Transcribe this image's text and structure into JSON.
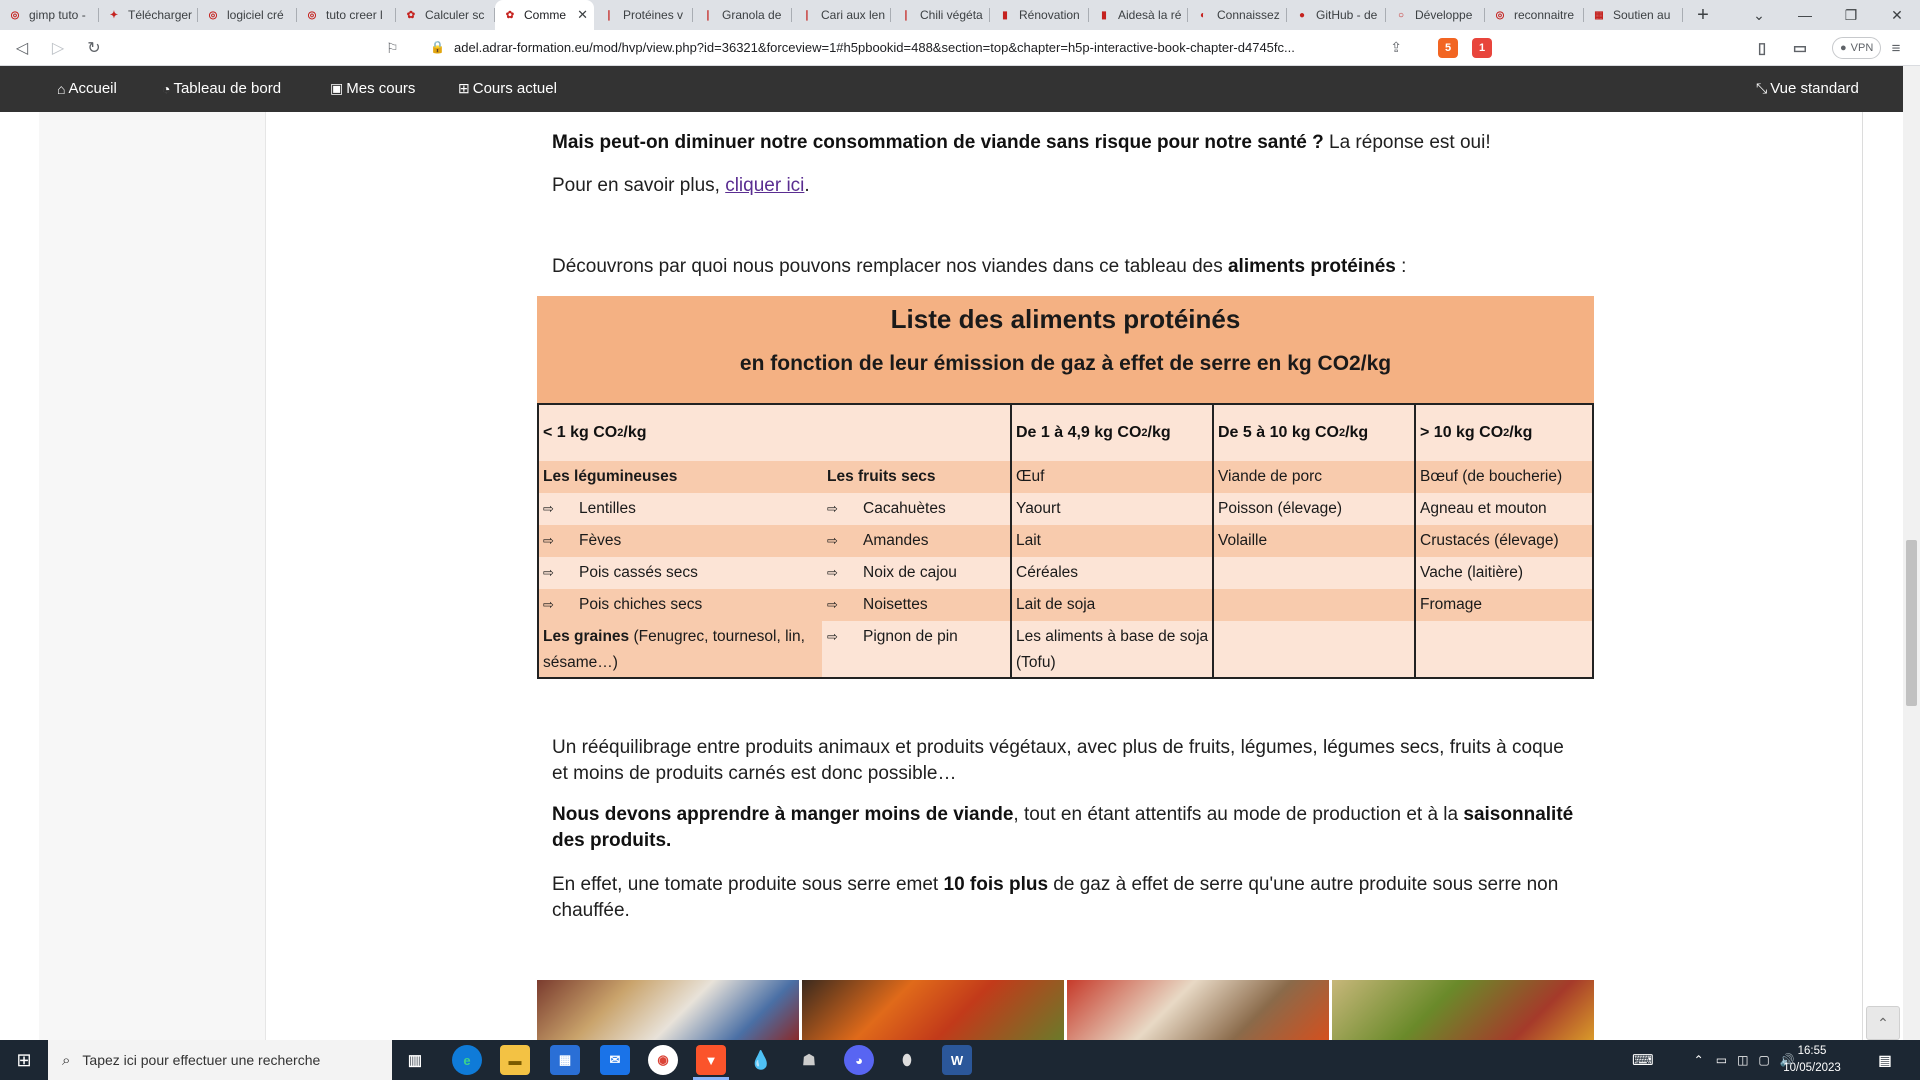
{
  "browser": {
    "tabs": [
      {
        "label": "gimp tuto - ",
        "favicon_color": "#e8eaed",
        "favicon_text": "◎",
        "active": false
      },
      {
        "label": "Télécharger",
        "favicon_color": "#e8eaed",
        "favicon_text": "✦",
        "active": false
      },
      {
        "label": "logiciel cré",
        "favicon_color": "#e8eaed",
        "favicon_text": "◎",
        "active": false
      },
      {
        "label": "tuto creer l",
        "favicon_color": "#e8eaed",
        "favicon_text": "◎",
        "active": false
      },
      {
        "label": "Calculer sc",
        "favicon_color": "#e8eaed",
        "favicon_text": "✿",
        "active": false
      },
      {
        "label": "Comme",
        "favicon_color": "#ffffff",
        "favicon_text": "✿",
        "active": true
      },
      {
        "label": "Protéines v",
        "favicon_color": "#e8eaed",
        "favicon_text": "❘",
        "active": false
      },
      {
        "label": "Granola de",
        "favicon_color": "#e8eaed",
        "favicon_text": "❘",
        "active": false
      },
      {
        "label": "Cari aux len",
        "favicon_color": "#e8eaed",
        "favicon_text": "❘",
        "active": false
      },
      {
        "label": "Chili végéta",
        "favicon_color": "#e8eaed",
        "favicon_text": "❘",
        "active": false
      },
      {
        "label": "Rénovation",
        "favicon_color": "#e8eaed",
        "favicon_text": "▮",
        "active": false
      },
      {
        "label": "Aidesà la ré",
        "favicon_color": "#e8eaed",
        "favicon_text": "▮",
        "active": false
      },
      {
        "label": "Connaissez",
        "favicon_color": "#e8eaed",
        "favicon_text": "◐",
        "active": false
      },
      {
        "label": "GitHub - de",
        "favicon_color": "#e8eaed",
        "favicon_text": "●",
        "active": false
      },
      {
        "label": "Développe",
        "favicon_color": "#e8eaed",
        "favicon_text": "○",
        "active": false
      },
      {
        "label": "reconnaitre",
        "favicon_color": "#e8eaed",
        "favicon_text": "◎",
        "active": false
      },
      {
        "label": "Soutien au",
        "favicon_color": "#e8eaed",
        "favicon_text": "▦",
        "active": false
      }
    ],
    "new_tab_icon": "plus-icon",
    "url": "adel.adrar-formation.eu/mod/hvp/view.php?id=36321&forceview=1#h5pbookid=488&section=top&chapter=h5p-interactive-book-chapter-d4745fc...",
    "vpn_label": "VPN",
    "ext_badges": [
      "5",
      "1"
    ]
  },
  "moodle_nav": {
    "home": "Accueil",
    "dashboard": "Tableau de bord",
    "my_courses": "Mes cours",
    "current_course": "Cours actuel",
    "standard_view": "Vue standard"
  },
  "content": {
    "p1_bold": "Mais peut-on diminuer notre consommation de viande sans risque pour notre santé ?",
    "p1_rest": " La réponse est oui!",
    "p2_prefix": "Pour en savoir plus, ",
    "p2_link": "cliquer ici",
    "p2_suffix": ".",
    "p3_prefix": "Découvrons par quoi nous pouvons remplacer nos viandes dans ce tableau des ",
    "p3_bold": "aliments protéinés",
    "p3_suffix": " :",
    "p4": "Un rééquilibrage entre produits animaux et produits végétaux, avec plus de fruits, légumes, légumes secs, fruits à coque et moins de produits carnés est donc possible…",
    "p5_bold1": "Nous devons apprendre à manger moins de viande",
    "p5_mid": ", tout en étant attentifs au mode de production et à la ",
    "p5_bold2": "saisonnalité des produits.",
    "p6_prefix": "En effet, une tomate produite sous serre emet ",
    "p6_bold": "10 fois plus",
    "p6_suffix": " de gaz à effet de serre qu'une autre produite sous serre non chauffée."
  },
  "table": {
    "title": "Liste des aliments protéinés",
    "subtitle": "en fonction de leur émission de gaz à effet de serre en kg CO2/kg",
    "headers": {
      "h1_pre": "< 1 kg CO",
      "h1_post": "/kg",
      "h2_pre": "De 1 à 4,9 kg CO",
      "h2_post": "/kg",
      "h3_pre": "De 5 à 10 kg CO",
      "h3_post": "/kg",
      "h4_pre": "> 10 kg CO",
      "h4_post": "/kg",
      "sub2": "2"
    },
    "col_legumineuses": "Les légumineuses",
    "col_fruits_secs": "Les fruits secs",
    "legumineuses": [
      "Lentilles",
      "Fèves",
      "Pois cassés secs",
      "Pois chiches secs"
    ],
    "fruits_secs": [
      "Cacahuètes",
      "Amandes",
      "Noix de cajou",
      "Noisettes",
      "Pignon de pin"
    ],
    "graines_bold": "Les graines",
    "graines_rest": " (Fenugrec, tournesol, lin, sésame…)",
    "col2": [
      "Œuf",
      "Yaourt",
      "Lait",
      "Céréales",
      "Lait de soja",
      "Les aliments à base de soja (Tofu)"
    ],
    "col3": [
      "Viande de porc",
      "Poisson (élevage)",
      "Volaille"
    ],
    "col4": [
      "Bœuf (de boucherie)",
      "Agneau et mouton",
      "Crustacés (élevage)",
      "Vache (laitière)",
      "Fromage"
    ],
    "arrow": "⇨"
  },
  "taskbar": {
    "search_placeholder": "Tapez ici pour effectuer une recherche",
    "time": "16:55",
    "date": "10/05/2023"
  },
  "colors": {
    "table_header": "#f4b183",
    "table_band_dark": "#f8cbad",
    "table_band_light": "#fce4d6",
    "moodle_nav": "#333333",
    "link": "#5a2d91"
  }
}
